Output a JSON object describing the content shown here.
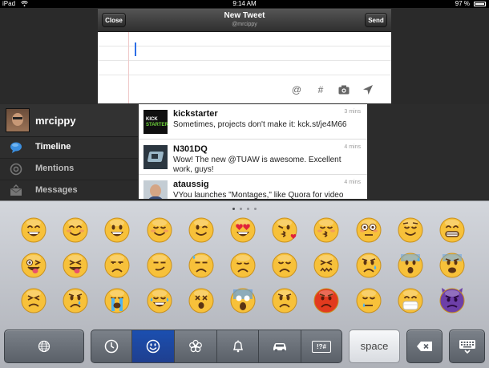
{
  "status_bar": {
    "device": "iPad",
    "time": "9:14 AM",
    "battery": "97 %"
  },
  "compose": {
    "title": "New Tweet",
    "account": "@mrcippy",
    "close_label": "Close",
    "send_label": "Send",
    "tools": [
      "@",
      "#"
    ]
  },
  "sidebar": {
    "username": "mrcippy",
    "items": [
      {
        "label": "Timeline",
        "icon": "speech-bubble-icon",
        "active": true
      },
      {
        "label": "Mentions",
        "icon": "at-sign-icon",
        "active": false
      },
      {
        "label": "Messages",
        "icon": "envelope-icon",
        "active": false
      }
    ]
  },
  "timeline": [
    {
      "name": "kickstarter",
      "time": "3 mins",
      "text": "Sometimes, projects don't make it: kck.st/je4M66",
      "avatar": "kickstarter-logo"
    },
    {
      "name": "N301DQ",
      "time": "4 mins",
      "text": "Wow! The new @TUAW is awesome. Excellent work, guys!",
      "avatar": "n301dq-avatar"
    },
    {
      "name": "ataussig",
      "time": "4 mins",
      "text": "VYou launches \"Montages,\" like Quora for video",
      "avatar": "ataussig-avatar"
    }
  ],
  "kickstarter_logo_text": [
    "KICK",
    "STARTER"
  ],
  "keyboard": {
    "page_count": 4,
    "current_page": 1,
    "emoji_rows": [
      [
        "grinning",
        "smile",
        "smiley",
        "relaxed",
        "wink",
        "heart-eyes",
        "kissing-heart",
        "kissing-closed-eyes",
        "flushed",
        "relieved",
        "grin"
      ],
      [
        "stuck-out-tongue-winking-eye",
        "stuck-out-tongue-closed-eyes",
        "unamused",
        "smirk",
        "sweat",
        "pensive",
        "disappointed",
        "confounded",
        "disappointed-relieved",
        "cold-sweat",
        "fearful"
      ],
      [
        "persevere",
        "cry",
        "sob",
        "joy",
        "astonished",
        "scream",
        "angry",
        "rage",
        "sleepy",
        "mask",
        "imp"
      ]
    ],
    "categories": [
      "recent-clock-icon",
      "people-smile-icon",
      "flower-icon",
      "bell-icon",
      "car-icon",
      "symbols-icon"
    ],
    "active_category": 1,
    "symbols_label": "!?#",
    "space_label": "space"
  },
  "colors": {
    "accent_blue": "#2a76c6",
    "active_segment": "#1b4fb0",
    "emoji_yellow": "#f7c13a",
    "emoji_red": "#e23a1e",
    "imp_purple": "#6d3fa8"
  }
}
